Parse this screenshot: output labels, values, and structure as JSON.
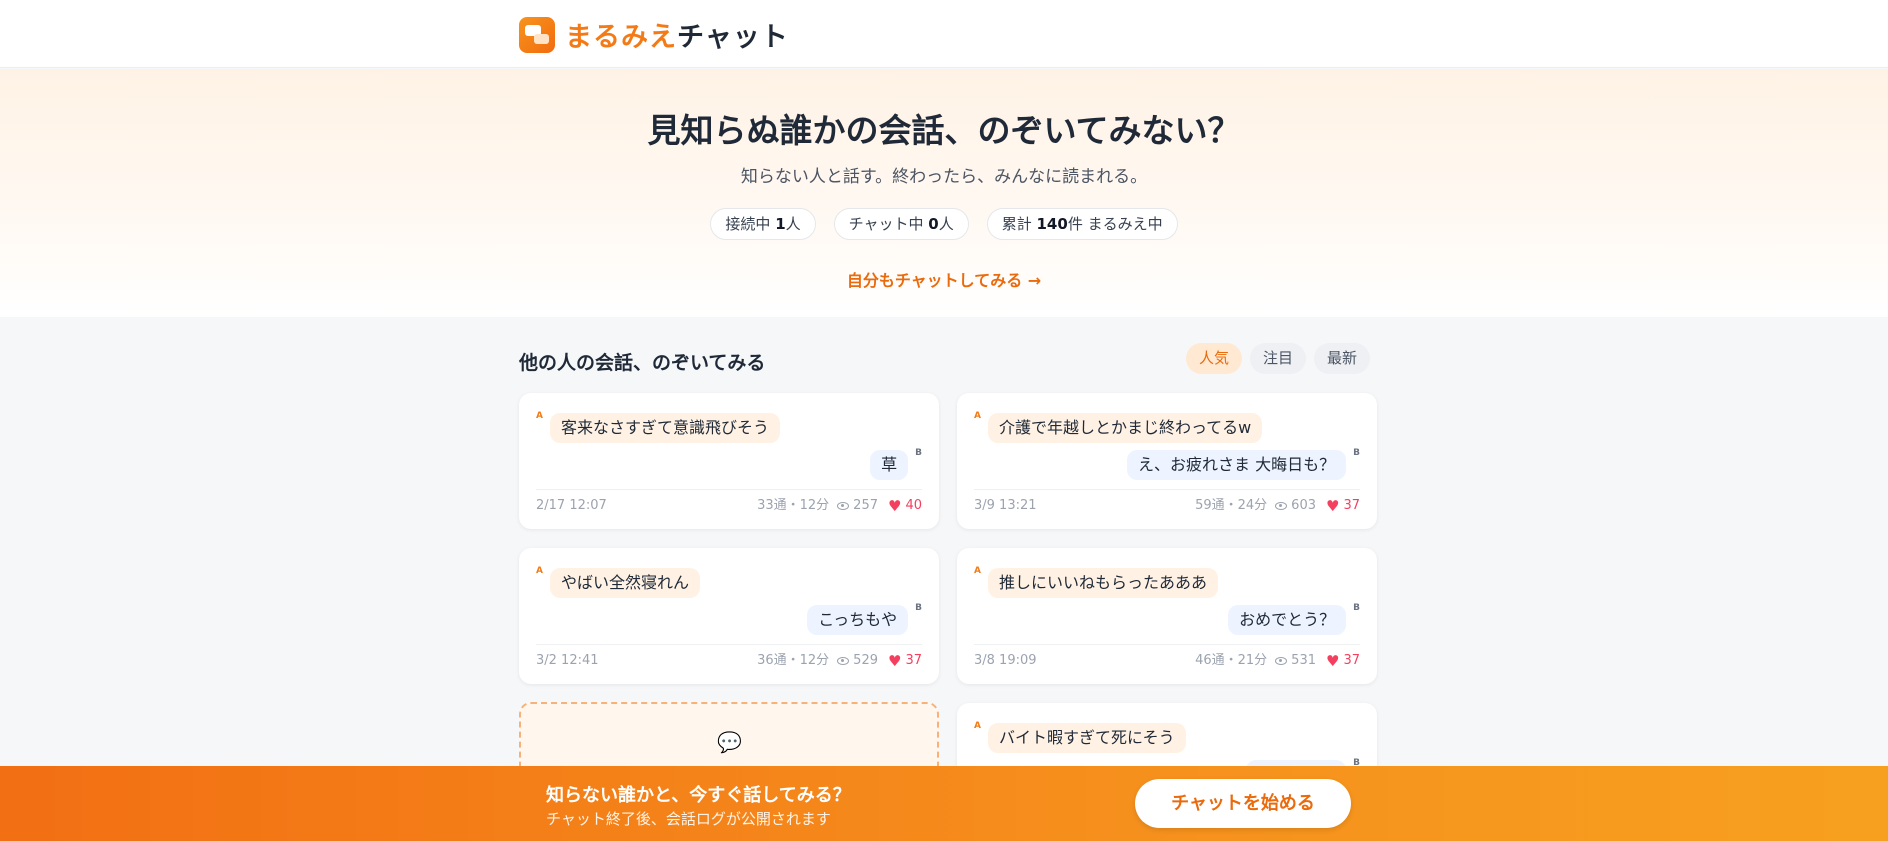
{
  "header": {
    "logo_part1": "まるみえ",
    "logo_part2": "チャット"
  },
  "hero": {
    "title": "見知らぬ誰かの会話、のぞいてみない？",
    "subtitle": "知らない人と話す。終わったら、みんなに読まれる。",
    "stats": [
      {
        "prefix": "接続中 ",
        "value": "1",
        "suffix": "人"
      },
      {
        "prefix": "チャット中 ",
        "value": "0",
        "suffix": "人"
      },
      {
        "prefix": "累計 ",
        "value": "140",
        "suffix": "件 まるみえ中"
      }
    ],
    "link": "自分もチャットしてみる →"
  },
  "section": {
    "title": "他の人の会話、のぞいてみる",
    "tabs": [
      "人気",
      "注目",
      "最新"
    ],
    "active_tab": "人気"
  },
  "cards": [
    {
      "a_label": "A",
      "a": "客来なさすぎて意識飛びそう",
      "b_label": "B",
      "b": "草",
      "date": "2/17 12:07",
      "stats": "33通・12分",
      "views": "257",
      "likes": "40"
    },
    {
      "a_label": "A",
      "a": "介護で年越しとかまじ終わってるw",
      "b_label": "B",
      "b": "え、お疲れさま 大晦日も？",
      "date": "3/9 13:21",
      "stats": "59通・24分",
      "views": "603",
      "likes": "37"
    },
    {
      "a_label": "A",
      "a": "やばい全然寝れん",
      "b_label": "B",
      "b": "こっちもや",
      "date": "3/2 12:41",
      "stats": "36通・12分",
      "views": "529",
      "likes": "37"
    },
    {
      "a_label": "A",
      "a": "推しにいいねもらったあああ",
      "b_label": "B",
      "b": "おめでとう？",
      "date": "3/8 19:09",
      "stats": "46通・21分",
      "views": "531",
      "likes": "37"
    },
    {
      "a_label": "A",
      "a": "バイト暇すぎて死にそう",
      "b_label": "B",
      "b": ""
    }
  ],
  "bottom_bar": {
    "title": "知らない誰かと、今すぐ話してみる？",
    "subtitle": "チャット終了後、会話ログが公開されます",
    "button": "チャットを始める"
  },
  "colors": {
    "accent": "#f47a16",
    "like": "#f43f5e"
  }
}
